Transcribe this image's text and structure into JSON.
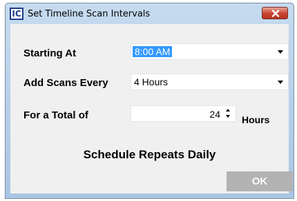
{
  "window": {
    "icon_label": "IC",
    "title": "Set Timeline Scan Intervals"
  },
  "form": {
    "starting_at": {
      "label": "Starting At",
      "value": "8:00 AM"
    },
    "add_scans_every": {
      "label": "Add Scans Every",
      "value": "4 Hours"
    },
    "total": {
      "label": "For a Total of",
      "value": "24",
      "unit": "Hours"
    }
  },
  "footer": {
    "schedule_text": "Schedule Repeats Daily",
    "ok_label": "OK"
  },
  "colors": {
    "selection": "#3399ff",
    "ok_button": "#b3b3b3",
    "close_button": "#c7422f"
  }
}
